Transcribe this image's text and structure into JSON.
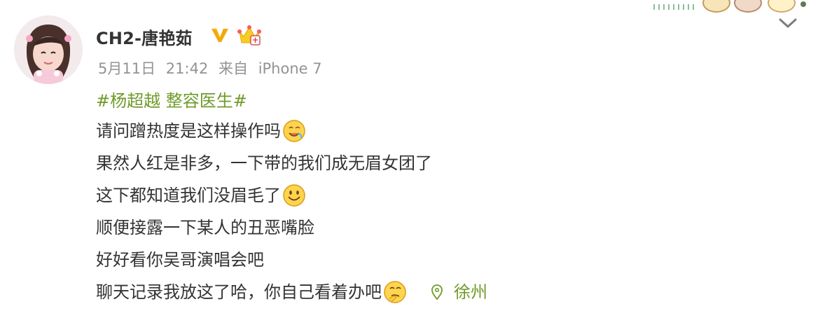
{
  "post": {
    "author": {
      "name": "CH2-唐艳茹",
      "verified_icon": "verified-v-icon",
      "vip_icon": "crown-icon"
    },
    "meta": {
      "date": "5月11日",
      "time": "21:42",
      "source_prefix": "来自",
      "device": "iPhone 7"
    },
    "topic": "#杨超越 整容医生#",
    "lines": [
      "请问蹭热度是这样操作吗",
      "果然人红是非多，一下带的我们成无眉女团了",
      "这下都知道我们没眉毛了",
      "顺便接露一下某人的丑恶嘴脸",
      "好好看你吴哥演唱会吧",
      "聊天记录我放这了哈，你自己看着办吧"
    ],
    "emojis": {
      "line1": "drooling-emoji",
      "line3": "smile-emoji",
      "line6": "thinking-emoji"
    },
    "location": "徐州",
    "location_icon": "location-pin-icon"
  },
  "ui": {
    "more_menu_icon": "chevron-down-icon",
    "topic_color": "#6f9b2a",
    "text_color": "#333333",
    "meta_color": "#939393"
  }
}
